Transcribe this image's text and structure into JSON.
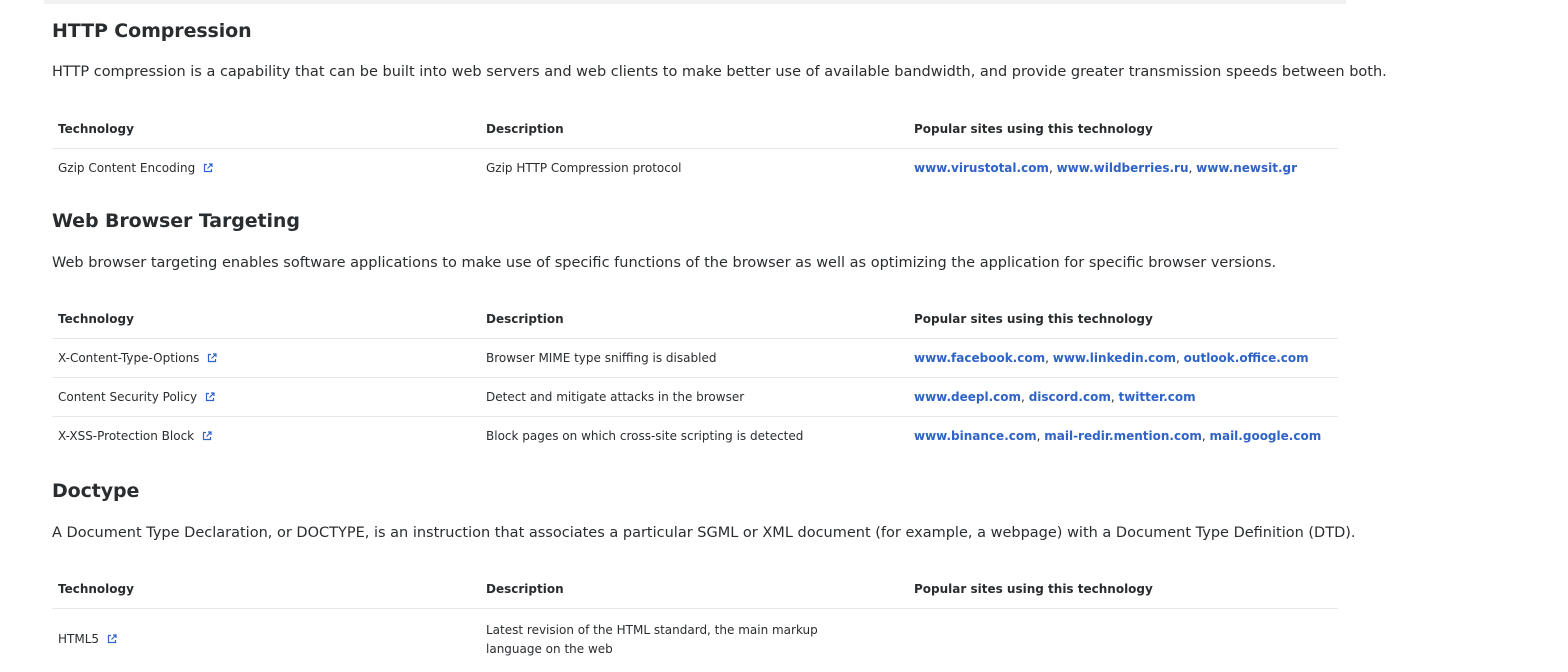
{
  "sections": [
    {
      "title": "HTTP Compression",
      "description": "HTTP compression is a capability that can be built into web servers and web clients to make better use of available bandwidth, and provide greater transmission speeds between both.",
      "headers": [
        "Technology",
        "Description",
        "Popular sites using this technology"
      ],
      "rows": [
        {
          "tech": "Gzip Content Encoding",
          "desc": "Gzip HTTP Compression protocol",
          "sites": [
            "www.virustotal.com",
            "www.wildberries.ru",
            "www.newsit.gr"
          ]
        }
      ]
    },
    {
      "title": "Web Browser Targeting",
      "description": "Web browser targeting enables software applications to make use of specific functions of the browser as well as optimizing the application for specific browser versions.",
      "headers": [
        "Technology",
        "Description",
        "Popular sites using this technology"
      ],
      "rows": [
        {
          "tech": "X-Content-Type-Options",
          "desc": "Browser MIME type sniffing is disabled",
          "sites": [
            "www.facebook.com",
            "www.linkedin.com",
            "outlook.office.com"
          ]
        },
        {
          "tech": "Content Security Policy",
          "desc": "Detect and mitigate attacks in the browser",
          "sites": [
            "www.deepl.com",
            "discord.com",
            "twitter.com"
          ]
        },
        {
          "tech": "X-XSS-Protection Block",
          "desc": "Block pages on which cross-site scripting is detected",
          "sites": [
            "www.binance.com",
            "mail-redir.mention.com",
            "mail.google.com"
          ]
        }
      ]
    },
    {
      "title": "Doctype",
      "description": "A Document Type Declaration, or DOCTYPE, is an instruction that associates a particular SGML or XML document (for example, a webpage) with a Document Type Definition (DTD).",
      "headers": [
        "Technology",
        "Description",
        "Popular sites using this technology"
      ],
      "rows": [
        {
          "tech": "HTML5",
          "desc": "Latest revision of the HTML standard, the main markup language on the web",
          "sites": []
        }
      ]
    }
  ],
  "colors": {
    "link": "#2f63c7",
    "text": "#2a2d30",
    "divider": "#e6e8ea"
  },
  "icons": {
    "external": "external-link-icon"
  }
}
